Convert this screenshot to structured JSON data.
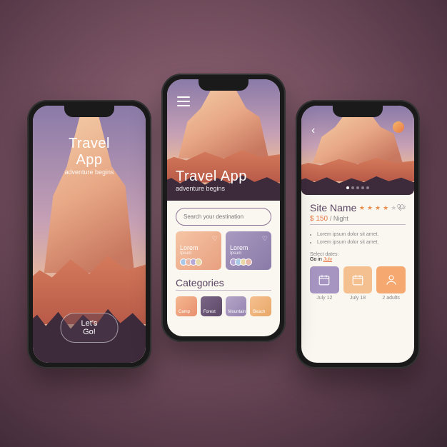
{
  "splash": {
    "title": "Travel App",
    "subtitle": "adventure begins",
    "cta": "Let's Go!"
  },
  "home": {
    "title": "Travel App",
    "subtitle": "adventure begins",
    "search_placeholder": "Search your destination",
    "cards": [
      {
        "title": "Lorem",
        "sub": "Ipsum"
      },
      {
        "title": "Lorem",
        "sub": "Ipsum"
      }
    ],
    "categories_label": "Categories",
    "categories": [
      "Camp",
      "Forest",
      "Mountain",
      "Beach"
    ]
  },
  "detail": {
    "site_name": "Site Name",
    "rating": "4.2",
    "price": "$ 150",
    "price_unit": "/ Night",
    "bullets": [
      "Lorem ipsum dolor sit amet.",
      "Lorem ipsum dolor sit amet."
    ],
    "select_dates": "Select dates:",
    "go_in": "Go in",
    "month": "July",
    "date1": "July 12",
    "date2": "July 18",
    "guests": "2 adults"
  }
}
